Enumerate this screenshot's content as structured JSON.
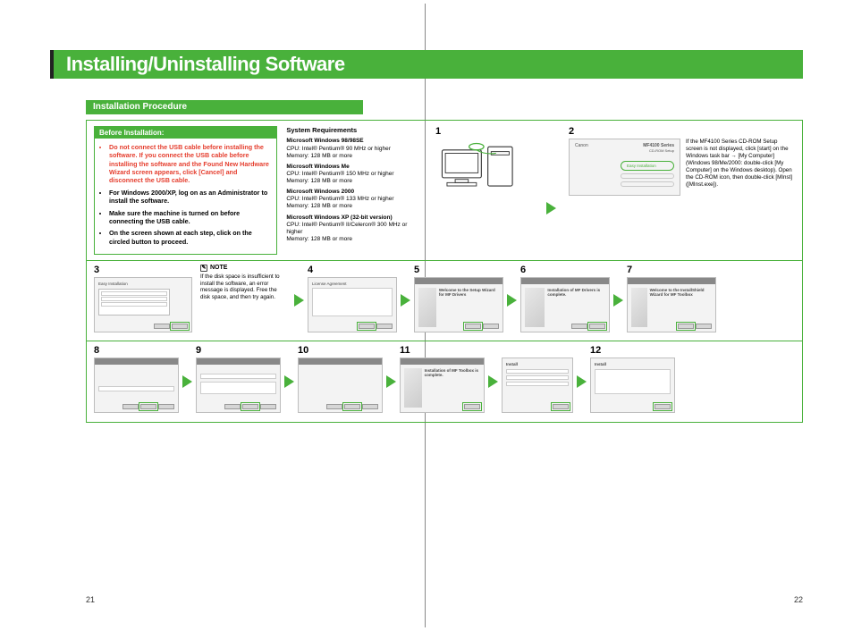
{
  "title": "Installing/Uninstalling Software",
  "subhead": "Installation Procedure",
  "before": {
    "head": "Before Installation:",
    "bullets": [
      "Do not connect the USB cable before installing the software. If you connect the USB cable before installing the software and the Found New Hardware Wizard screen appears, click [Cancel] and disconnect the USB cable.",
      "For Windows 2000/XP, log on as an Administrator to install the software.",
      "Make sure the machine is turned on before connecting the USB cable.",
      "On the screen shown at each step, click on the circled button to proceed."
    ]
  },
  "sysreq": {
    "title": "System Requirements",
    "rows": [
      {
        "name": "Microsoft Windows 98/98SE",
        "cpu": "CPU: Intel® Pentium® 90 MHz or higher",
        "mem": "Memory: 128 MB or more"
      },
      {
        "name": "Microsoft Windows Me",
        "cpu": "CPU: Intel® Pentium® 150 MHz or higher",
        "mem": "Memory: 128 MB or more"
      },
      {
        "name": "Microsoft Windows 2000",
        "cpu": "CPU: Intel® Pentium® 133 MHz or higher",
        "mem": "Memory: 128 MB or more"
      },
      {
        "name": "Microsoft Windows XP (32-bit version)",
        "cpu": "CPU: Intel® Pentium® II/Celeron® 300 MHz or higher",
        "mem": "Memory: 128 MB or more"
      }
    ]
  },
  "steps": {
    "s1": "1",
    "s2": "2",
    "s3": "3",
    "s4": "4",
    "s5": "5",
    "s6": "6",
    "s7": "7",
    "s8": "8",
    "s9": "9",
    "s10": "10",
    "s11": "11",
    "s12": "12"
  },
  "screen2": {
    "brand": "Canon",
    "product": "MF4100 Series",
    "sub": "CD-ROM Setup",
    "btn": "Easy Installation"
  },
  "cdtext": "If the MF4100 Series CD-ROM Setup screen is not displayed, click [start] on the Windows task bar → [My Computer] (Windows 98/Me/2000: double-click [My Computer] on the Windows desktop). Open the CD-ROM icon, then double-click [MInst] ([MInst.exe]).",
  "note": {
    "head": "NOTE",
    "body": "If the disk space is insufficient to install the software, an error message is displayed. Free the disk space, and then try again."
  },
  "mini": {
    "s3_title": "Easy Installation",
    "s4_title": "License Agreement",
    "s5_title": "Welcome to the Setup Wizard for MF Drivers",
    "s6_title": "Installation of MF Drivers is complete.",
    "s7_title": "Welcome to the InstallShield Wizard for MF Toolbox",
    "s11_title": "Installation of MF Toolbox is complete.",
    "s12a_title": "Install",
    "s12b_title": "Install"
  },
  "pages": {
    "left": "21",
    "right": "22"
  }
}
